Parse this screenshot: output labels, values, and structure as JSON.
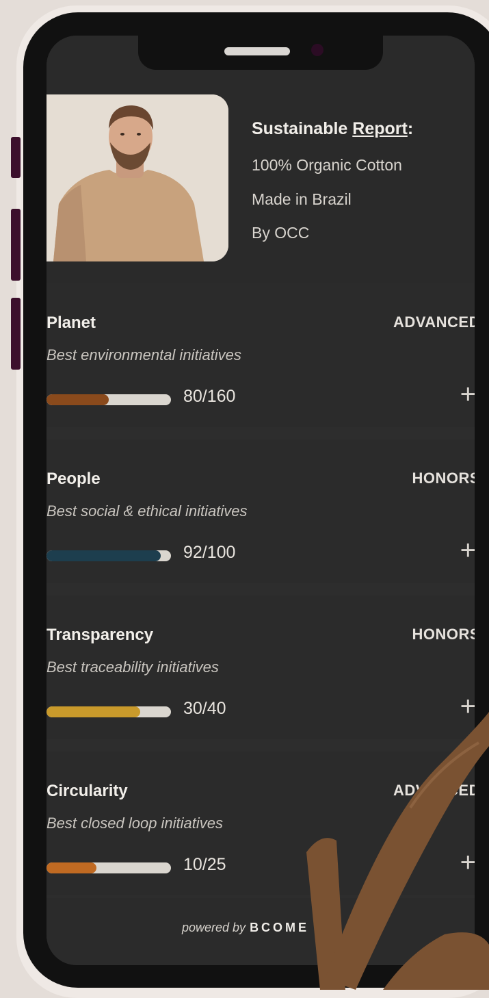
{
  "product": {
    "report_label": "Sustainable ",
    "report_link": "Report",
    "report_colon": ":",
    "lines": [
      "100% Organic Cotton",
      "Made in Brazil",
      "By OCC"
    ]
  },
  "cards": [
    {
      "title": "Planet",
      "level": "ADVANCED",
      "description": "Best environmental initiatives",
      "score": "80/160",
      "progress": 0.5,
      "color": "#8a4a1c"
    },
    {
      "title": "People",
      "level": "HONORS",
      "description": "Best social & ethical initiatives",
      "score": "92/100",
      "progress": 0.92,
      "color": "#1d3e4e"
    },
    {
      "title": "Transparency",
      "level": "HONORS",
      "description": "Best traceability initiatives",
      "score": "30/40",
      "progress": 0.75,
      "color": "#c99a2b"
    },
    {
      "title": "Circularity",
      "level": "ADVANCED",
      "description": "Best closed loop initiatives",
      "score": "10/25",
      "progress": 0.4,
      "color": "#c06a22"
    }
  ],
  "footer": {
    "powered_by": "powered by",
    "brand": "BCOME"
  },
  "icons": {
    "expand": "plus-icon"
  }
}
